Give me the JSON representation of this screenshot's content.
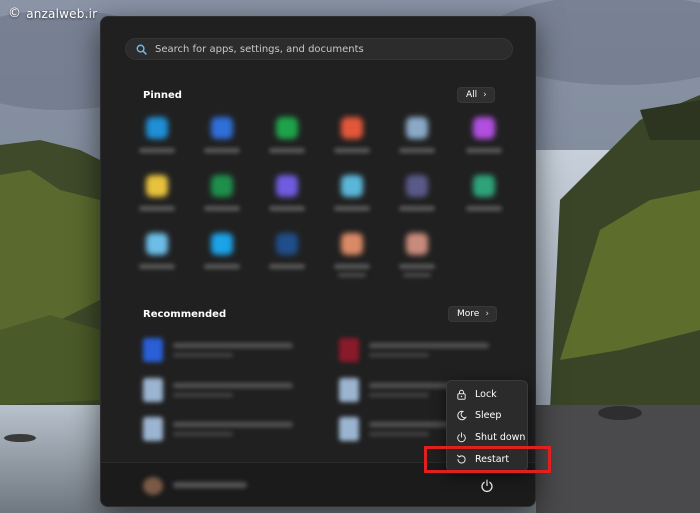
{
  "watermark": {
    "symbol": "©",
    "text": "anzalweb.ir"
  },
  "search": {
    "placeholder": "Search for apps, settings, and documents",
    "value": ""
  },
  "pinned": {
    "title": "Pinned",
    "all_label": "All",
    "apps": [
      {
        "color": "#1f8fd6"
      },
      {
        "color": "#2f6fd8"
      },
      {
        "color": "#1fa34a"
      },
      {
        "color": "#e2573a"
      },
      {
        "color": "#8aa9c8"
      },
      {
        "color": "#b14fe0"
      },
      {
        "color": "#e8c23c"
      },
      {
        "color": "#1e8f4a"
      },
      {
        "color": "#6f5ce0"
      },
      {
        "color": "#5bb7d9"
      },
      {
        "color": "#5a5a8a"
      },
      {
        "color": "#2ea37a"
      },
      {
        "color": "#6cbde8"
      },
      {
        "color": "#1ba2e8"
      },
      {
        "color": "#1f4e8a"
      },
      {
        "color": "#d98a66"
      },
      {
        "color": "#c98b7c"
      }
    ]
  },
  "recommended": {
    "title": "Recommended",
    "more_label": "More",
    "items": [
      {
        "color": "#2a5fd6"
      },
      {
        "color": "#8a1a2a"
      },
      {
        "color": "#9bb4d0"
      },
      {
        "color": "#9bb4d0"
      },
      {
        "color": "#9bb4d0"
      },
      {
        "color": "#9bb4d0"
      }
    ]
  },
  "power_menu": {
    "items": [
      {
        "label": "Lock",
        "icon": "lock-icon"
      },
      {
        "label": "Sleep",
        "icon": "moon-icon"
      },
      {
        "label": "Shut down",
        "icon": "power-icon"
      },
      {
        "label": "Restart",
        "icon": "restart-icon"
      }
    ],
    "highlight_color": "#e01f1f"
  },
  "footer": {
    "power_icon": "power-icon"
  }
}
